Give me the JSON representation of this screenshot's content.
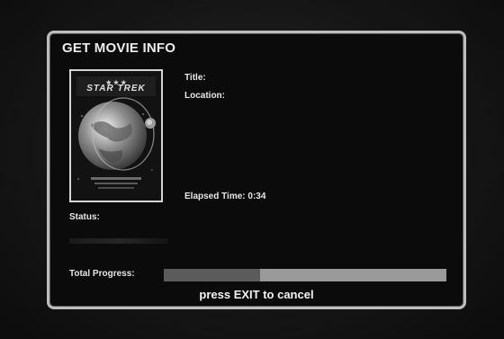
{
  "dialog": {
    "title": "GET MOVIE INFO",
    "title_label": "Title:",
    "location_label": "Location:",
    "elapsed_label": "Elapsed Time: 0:34",
    "status_label": "Status:",
    "progress_label": "Total Progress:",
    "progress_fraction": 0.34,
    "hint": "press EXIT to cancel"
  },
  "poster": {
    "title_text": "STAR TREK",
    "icon": "movie-poster-earth"
  },
  "colors": {
    "progress_fill": "#5c5c5c",
    "progress_track": "#9a9a9a",
    "border": "#bdbdbd"
  }
}
